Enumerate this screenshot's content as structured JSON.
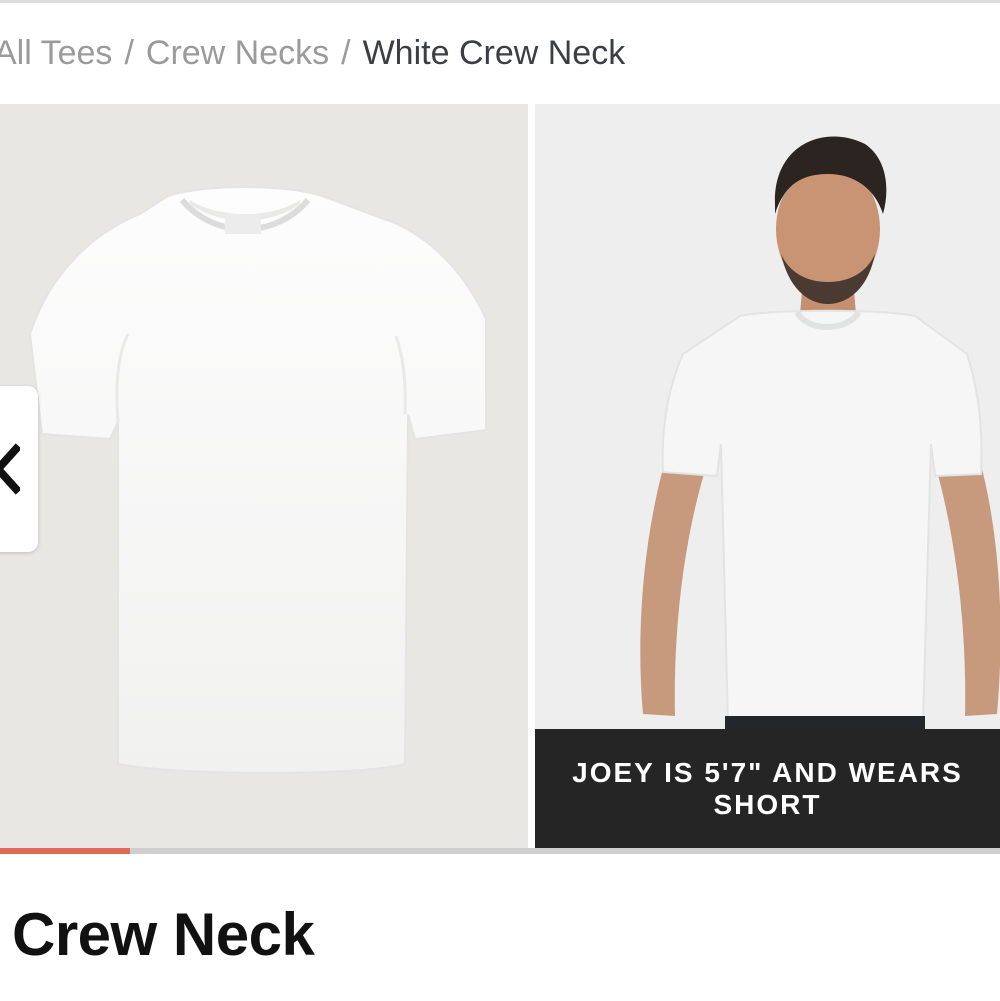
{
  "breadcrumb": {
    "items": [
      {
        "label": "All Tees"
      },
      {
        "label": "Crew Necks"
      }
    ],
    "separator": "/",
    "current": "White Crew Neck"
  },
  "gallery": {
    "slides": [
      {
        "image": "white-tshirt-flat-lay"
      },
      {
        "image": "model-wearing-white-tshirt",
        "caption": "JOEY IS 5'7\" AND WEARS SHORT"
      }
    ],
    "prev_icon": "chevron-left-icon",
    "progress": 0.13,
    "colors": {
      "progress_fill": "#e06a55",
      "caption_bg": "#252525"
    }
  },
  "product": {
    "title": "Crew Neck"
  }
}
